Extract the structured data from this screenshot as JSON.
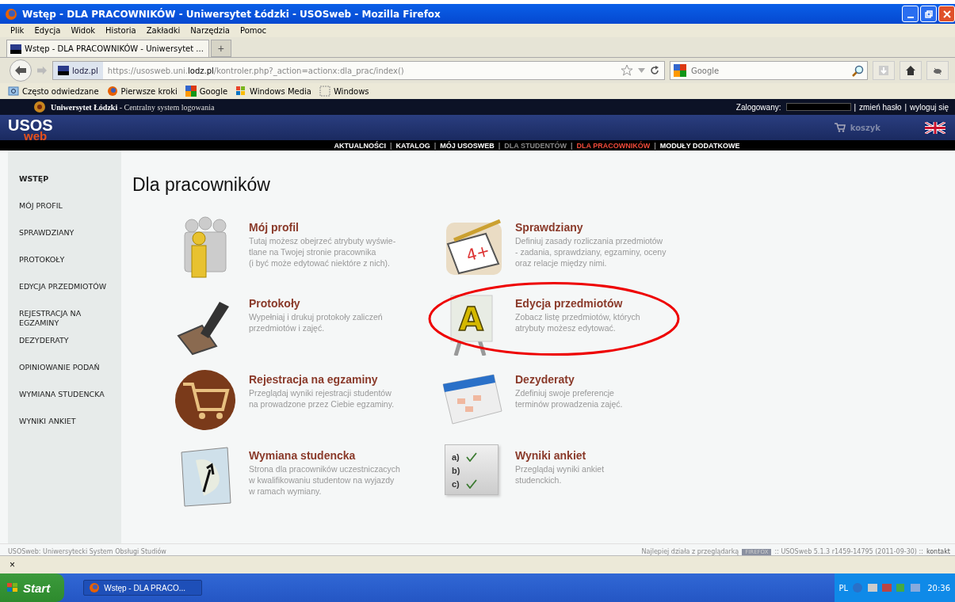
{
  "window": {
    "title": "Wstęp - DLA PRACOWNIKÓW - Uniwersytet Łódzki - USOSweb - Mozilla Firefox"
  },
  "menu": [
    "Plik",
    "Edycja",
    "Widok",
    "Historia",
    "Zakładki",
    "Narzędzia",
    "Pomoc"
  ],
  "tabs": [
    {
      "label": "Wstęp - DLA PRACOWNIKÓW - Uniwersytet ...",
      "selected": true
    }
  ],
  "new_tab": "+",
  "address": {
    "site": "lodz.pl",
    "url_pre": "https://usosweb.uni.",
    "url_host": "lodz.pl",
    "url_post": "/kontroler.php?_action=actionx:dla_prac/index()"
  },
  "search": {
    "placeholder": "Google"
  },
  "bookmarks": [
    {
      "label": "Często odwiedzane",
      "kind": "folder"
    },
    {
      "label": "Pierwsze kroki",
      "kind": "firefox"
    },
    {
      "label": "Google",
      "kind": "google"
    },
    {
      "label": "Windows Media",
      "kind": "windows"
    },
    {
      "label": "Windows",
      "kind": "page"
    }
  ],
  "site_header": {
    "university": "Uniwersytet Łódzki",
    "system": " - Centralny system logowania",
    "logged_label": "Zalogowany:",
    "links": [
      "zmień hasło",
      "wyloguj się"
    ],
    "separator": "|",
    "logo_top": "USOS",
    "logo_bottom": "web",
    "cart": "koszyk"
  },
  "nav_separator": "|",
  "nav": [
    {
      "label": "AKTUALNOŚCI",
      "selected": false,
      "disabled": false
    },
    {
      "label": "KATALOG",
      "selected": false,
      "disabled": false
    },
    {
      "label": "MÓJ USOSWEB",
      "selected": false,
      "disabled": false
    },
    {
      "label": "DLA STUDENTÓW",
      "selected": false,
      "disabled": true
    },
    {
      "label": "DLA PRACOWNIKÓW",
      "selected": true,
      "disabled": false
    },
    {
      "label": "MODUŁY DODATKOWE",
      "selected": false,
      "disabled": false
    }
  ],
  "sidebar": {
    "items": [
      {
        "label": "WSTĘP",
        "selected": true
      },
      {
        "label": "MÓJ PROFIL",
        "selected": false
      },
      {
        "label": "SPRAWDZIANY",
        "selected": false
      },
      {
        "label": "PROTOKOŁY",
        "selected": false
      },
      {
        "label": "EDYCJA PRZEDMIOTÓW",
        "selected": false
      },
      {
        "label": "REJESTRACJA NA EGZAMINY",
        "selected": false
      },
      {
        "label": "DEZYDERATY",
        "selected": false
      },
      {
        "label": "OPINIOWANIE PODAŃ",
        "selected": false
      },
      {
        "label": "WYMIANA STUDENCKA",
        "selected": false
      },
      {
        "label": "WYNIKI ANKIET",
        "selected": false
      }
    ]
  },
  "heading": "Dla pracowników",
  "modules": [
    {
      "kind": "people",
      "title": "Mój profil",
      "lines": [
        "Tutaj możesz obejrzeć atrybuty wyświe-",
        "tlane na Twojej stronie pracownika",
        "(i być może edytować niektóre z nich)."
      ],
      "circled": false
    },
    {
      "kind": "exam",
      "title": "Sprawdziany",
      "lines": [
        "Definiuj zasady rozliczania przedmiotów",
        "- zadania, sprawdziany, egzaminy, oceny",
        "oraz relacje między nimi."
      ],
      "circled": false,
      "grade": "4+"
    },
    {
      "kind": "stamp",
      "title": "Protokoły",
      "lines": [
        "Wypełniaj i drukuj protokoły zaliczeń",
        "przedmiotów i zajęć."
      ],
      "circled": false
    },
    {
      "kind": "board",
      "title": "Edycja przedmiotów",
      "lines": [
        "Zobacz listę przedmiotów, których",
        "atrybuty możesz edytować."
      ],
      "circled": true,
      "letter": "A"
    },
    {
      "kind": "cart",
      "title": "Rejestracja na egzaminy",
      "lines": [
        "Przeglądaj wyniki rejestracji studentów",
        "na prowadzone przez Ciebie egzaminy."
      ],
      "circled": false
    },
    {
      "kind": "calendar",
      "title": "Dezyderaty",
      "lines": [
        "Zdefiniuj swoje preferencje",
        "terminów prowadzenia zajęć."
      ],
      "circled": false
    },
    {
      "kind": "map",
      "title": "Wymiana studencka",
      "lines": [
        "Strona dla pracowników uczestniczacych",
        "w kwalifikowaniu studentow na wyjazdy",
        "w ramach wymiany."
      ],
      "circled": false
    },
    {
      "kind": "survey",
      "title": "Wyniki ankiet",
      "lines": [
        "Przeglądaj wyniki ankiet",
        "studenckich."
      ],
      "circled": false,
      "options": [
        "a)",
        "b)",
        "c)"
      ]
    }
  ],
  "footer": {
    "left": "USOSweb: Uniwersytecki System Obsługi Studiów",
    "best": "Najlepiej działa z przeglądarką",
    "badge": "FIREFOX",
    "version": ":: USOSweb 5.1.3 r1459-14795 (2011-09-30) ::",
    "contact": "kontakt"
  },
  "findbar": {
    "close": "×"
  },
  "taskbar": {
    "start": "Start",
    "task": "Wstęp - DLA PRACO...",
    "lang": "PL",
    "time": "20:36"
  }
}
